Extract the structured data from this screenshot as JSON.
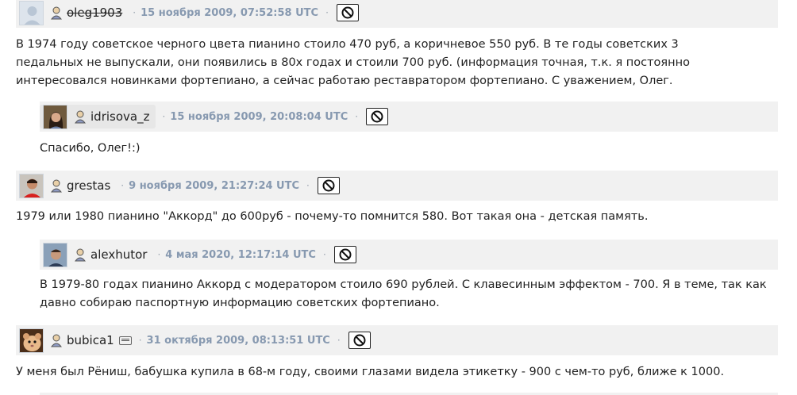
{
  "comments": [
    {
      "username": "oleg1903",
      "deleted": true,
      "timestamp": "15 ноября 2009, 07:52:58 UTC",
      "text": "В 1974 году советское черного цвета пианино стоило 470 руб, а коричневое 550 руб. В те годы советских 3 педальных не выпускали, они появились в 80х годах и стоили 700 руб. (информация точная, т.к. я постоянно интересовался новинками фортепиано, а сейчас работаю реставратором фортепиано. С уважением, Олег."
    },
    {
      "username": "idrisova_z",
      "timestamp": "15 ноября 2009, 20:08:04 UTC",
      "text": "Спасибо, Олег!:)"
    },
    {
      "username": "grestas",
      "timestamp": "9 ноября 2009, 21:27:24 UTC",
      "text": "1979 или 1980 пианино \"Аккорд\" до 600руб - почему-то помнится 580. Вот такая она - детская память."
    },
    {
      "username": "alexhutor",
      "timestamp": "4 мая 2020, 12:17:14 UTC",
      "text": "В 1979-80 годах пианино Аккорд с модератором стоило 690 рублей. С клавесинным эффектом - 700. Я в теме, так как давно собираю паспортную информацию советских фортепиано."
    },
    {
      "username": "bubica1",
      "badge": "paid-account-badge",
      "timestamp": "31 октября 2009, 08:13:51 UTC",
      "text": "У меня был Рёниш, бабушка купила в 68-м году, своими глазами видела этикетку - 900 с чем-то руб, ближе к 1000."
    }
  ],
  "separator": "·",
  "icons": {
    "user": "user-icon",
    "ban": "ban-icon"
  },
  "colors": {
    "bar_bg": "#f1f1f1",
    "timestamp": "#8799b0",
    "highlight": "#e7e7e7"
  }
}
